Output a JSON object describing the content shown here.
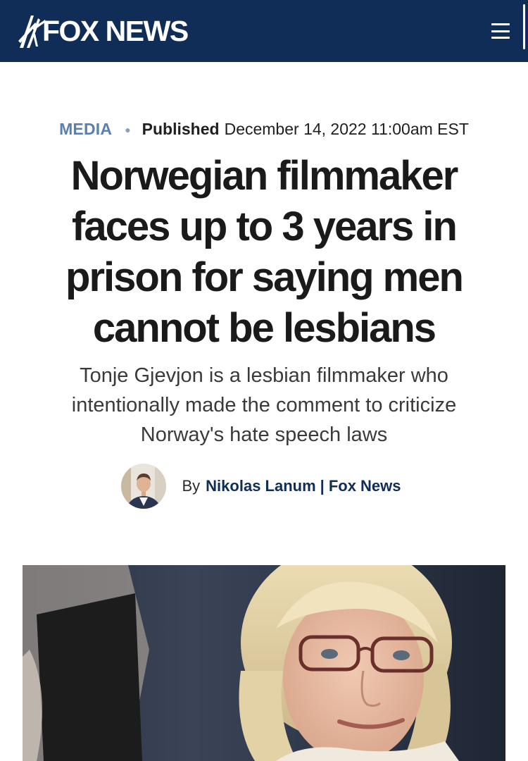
{
  "header": {
    "logo_text": "FOX NEWS",
    "logo_icon": "fox-searchlight-icon",
    "menu_icon": "hamburger-menu-icon",
    "background_color": "#0f2d56"
  },
  "article": {
    "category": "MEDIA",
    "published_label": "Published",
    "published_date": "December 14, 2022 11:00am EST",
    "headline": "Norwegian filmmaker faces up to 3 years in prison for saying men cannot be lesbians",
    "subheadline": "Tonje Gjevjon is a lesbian filmmaker who intentionally made the comment to criticize Norway's hate speech laws",
    "byline": {
      "prefix": "By",
      "author": "Nikolas Lanum",
      "separator": "|",
      "outlet": "Fox News"
    },
    "hero_image": "photo-of-woman-with-glasses"
  },
  "colors": {
    "accent": "#0f2d56",
    "category": "#5a80b0"
  }
}
